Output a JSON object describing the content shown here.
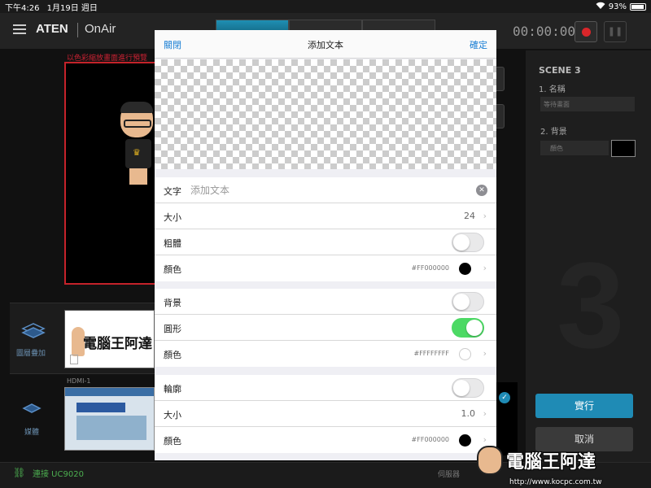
{
  "status_bar": {
    "time": "下午4:26",
    "date": "1月19日 週日",
    "battery": "93%",
    "battery_level": 0.93
  },
  "header": {
    "brand": "ATEN",
    "product": "OnAir",
    "timer": "00:00:00"
  },
  "background_app": {
    "preview_warning": "以色彩縮放畫面進行預覽",
    "layer_label": "圖層疊加",
    "thumb_text": "電腦王阿達",
    "hdmi_label": "HDMI-1",
    "media_label": "媒體",
    "connection_status": "連接 UC9020",
    "server_label": "伺服器",
    "scene": {
      "title": "SCENE 3",
      "name_label": "1. 名稱",
      "name_value": "等待畫面",
      "bg_label": "2. 背景",
      "bg_select": "顏色",
      "big_number": "3",
      "exec_label": "實行",
      "cancel_label": "取消"
    },
    "colors": {
      "accent": "#1f8bb5",
      "record": "#d9262a",
      "connected": "#4caf50"
    }
  },
  "watermark": {
    "text": "電腦王阿達",
    "url": "http://www.kocpc.com.tw"
  },
  "modal": {
    "close_label": "關閉",
    "title": "添加文本",
    "confirm_label": "確定",
    "text_row": {
      "label": "文字",
      "placeholder": "添加文本",
      "value": ""
    },
    "size_row": {
      "label": "大小",
      "value": "24"
    },
    "bold_row": {
      "label": "粗體",
      "enabled": false
    },
    "color_row": {
      "label": "顏色",
      "hex": "#FF000000",
      "swatch": "#000000"
    },
    "background_row": {
      "label": "背景",
      "enabled": false
    },
    "rounded_row": {
      "label": "圓形",
      "enabled": true
    },
    "bg_color_row": {
      "label": "顏色",
      "hex": "#FFFFFFFF",
      "swatch": "#ffffff"
    },
    "outline_row": {
      "label": "輪廓",
      "enabled": false
    },
    "outline_size_row": {
      "label": "大小",
      "value": "1.0"
    },
    "outline_color_row": {
      "label": "顏色",
      "hex": "#FF000000",
      "swatch": "#000000"
    },
    "colors": {
      "link": "#1a7fd4",
      "toggle_on": "#4cd964"
    }
  }
}
